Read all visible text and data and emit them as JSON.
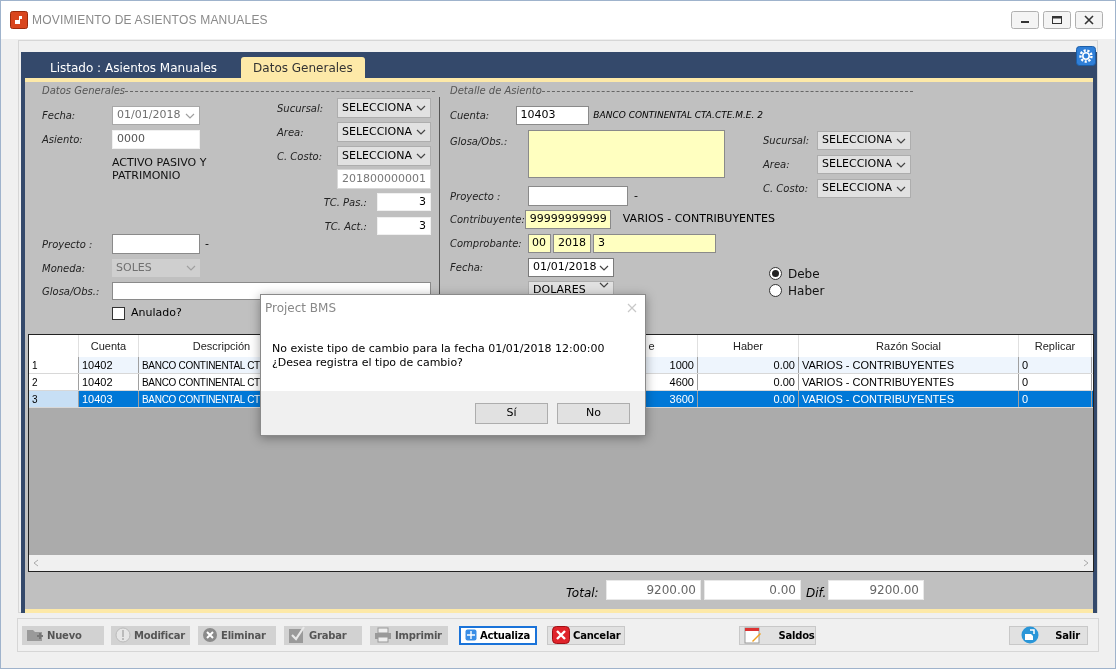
{
  "window": {
    "title": "MOVIMIENTO DE ASIENTOS MANUALES"
  },
  "tabs": [
    {
      "label": "Listado : Asientos Manuales",
      "selected": false
    },
    {
      "label": "Datos Generales",
      "selected": true
    }
  ],
  "datos_generales": {
    "legend": "Datos Generales",
    "fecha": {
      "label": "Fecha:",
      "value": "01/01/2018",
      "disabled": true
    },
    "asiento": {
      "label": "Asiento:",
      "value": "0000"
    },
    "cuenta_grupo": "ACTIVO PASIVO Y PATRIMONIO",
    "proyecto": {
      "label": "Proyecto :",
      "suffix": "-"
    },
    "moneda": {
      "label": "Moneda:",
      "value": "SOLES",
      "disabled": true
    },
    "glosa": {
      "label": "Glosa/Obs.:"
    },
    "anulado": {
      "label": "Anulado?",
      "checked": false
    },
    "sucursal": {
      "label": "Sucursal:",
      "value": "SELECCIONA"
    },
    "area": {
      "label": "Area:",
      "value": "SELECCIONA"
    },
    "c_costo": {
      "label": "C. Costo:",
      "value": "SELECCIONA"
    },
    "numero": "201800000001",
    "tc_pas": {
      "label": "TC. Pas.:",
      "value": "3"
    },
    "tc_act": {
      "label": "TC. Act.:",
      "value": "3"
    }
  },
  "detalle_asiento": {
    "legend": "Detalle de Asiento",
    "cuenta": {
      "label": "Cuenta:",
      "value": "10403",
      "name": "BANCO CONTINENTAL CTA.CTE.M.E. 2"
    },
    "glosa": {
      "label": "Glosa/Obs.:",
      "highlighted": true
    },
    "proyecto": {
      "label": "Proyecto :",
      "suffix": "-"
    },
    "contribuyente": {
      "label": "Contribuyente:",
      "value": "99999999999",
      "highlighted": true,
      "name": "VARIOS - CONTRIBUYENTES"
    },
    "comprobante": {
      "label": "Comprobante:",
      "parts": [
        "00",
        "2018",
        "3"
      ],
      "highlighted": true
    },
    "fecha": {
      "label": "Fecha:",
      "value": "01/01/2018"
    },
    "moneda": {
      "value": "DOLARES"
    },
    "sucursal": {
      "label": "Sucursal:",
      "value": "SELECCIONA"
    },
    "area": {
      "label": "Area:",
      "value": "SELECCIONA"
    },
    "c_costo": {
      "label": "C. Costo:",
      "value": "SELECCIONA"
    },
    "tipo": [
      {
        "label": "Debe",
        "selected": true
      },
      {
        "label": "Haber",
        "selected": false
      }
    ]
  },
  "table": {
    "columns": [
      "Cuenta",
      "Descripción",
      "e",
      "Haber",
      "Razón Social",
      "Replicar"
    ],
    "rows": [
      {
        "number": "1",
        "cells": [
          "10402",
          "BANCO CONTINENTAL CT",
          "1000",
          "0.00",
          "VARIOS - CONTRIBUYENTES",
          "0"
        ],
        "selected": false
      },
      {
        "number": "2",
        "cells": [
          "10402",
          "BANCO CONTINENTAL CT",
          "4600",
          "0.00",
          "VARIOS - CONTRIBUYENTES",
          "0"
        ],
        "selected": false
      },
      {
        "number": "3",
        "cells": [
          "10403",
          "BANCO CONTINENTAL CT",
          "3600",
          "0.00",
          "VARIOS - CONTRIBUYENTES",
          "0"
        ],
        "selected": true
      }
    ]
  },
  "totals": {
    "label": "Total:",
    "debe": "9200.00",
    "haber": "0.00",
    "dif_label": "Dif.",
    "dif": "9200.00"
  },
  "toolbar": [
    {
      "label": "Nuevo",
      "disabled": true
    },
    {
      "label": "Modificar",
      "disabled": true
    },
    {
      "label": "Eliminar",
      "disabled": true
    },
    {
      "label": "Grabar",
      "disabled": true
    },
    {
      "label": "Imprimir",
      "disabled": true
    },
    {
      "label": "Actualiza",
      "disabled": false,
      "focused": true
    },
    {
      "label": "Cancelar",
      "disabled": false
    },
    {
      "label": "Saldos",
      "disabled": false
    },
    {
      "label": "Salir",
      "disabled": false
    }
  ],
  "dialog": {
    "title": "Project BMS",
    "message": "No existe tipo de cambio para la fecha 01/01/2018 12:00:00 ¿Desea registra el tipo de cambio?",
    "buttons": [
      {
        "label": "Sí"
      },
      {
        "label": "No"
      }
    ]
  }
}
